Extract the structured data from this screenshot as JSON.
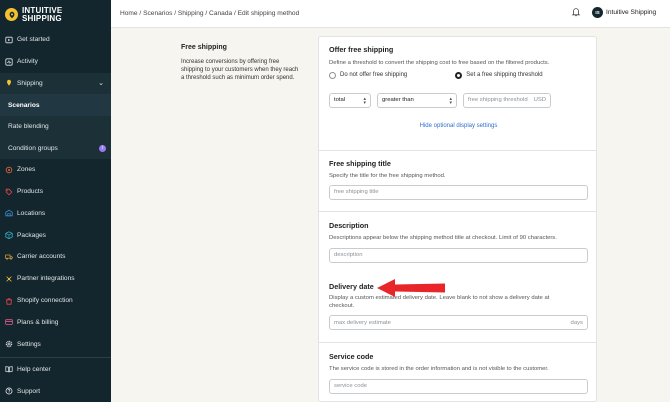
{
  "brand": {
    "line1": "INTUITIVE",
    "line2": "SHIPPING"
  },
  "sidebar": {
    "items": [
      {
        "label": "Get started",
        "icon": "play-icon"
      },
      {
        "label": "Activity",
        "icon": "activity-icon"
      },
      {
        "label": "Shipping",
        "icon": "shipping-icon"
      }
    ],
    "subitems": [
      {
        "label": "Scenarios"
      },
      {
        "label": "Rate blending"
      },
      {
        "label": "Condition groups",
        "badge": "i"
      }
    ],
    "items2": [
      {
        "label": "Zones"
      },
      {
        "label": "Products"
      },
      {
        "label": "Locations"
      },
      {
        "label": "Packages"
      },
      {
        "label": "Carrier accounts"
      },
      {
        "label": "Partner integrations"
      },
      {
        "label": "Shopify connection"
      },
      {
        "label": "Plans & billing"
      },
      {
        "label": "Settings"
      }
    ],
    "bottom": [
      {
        "label": "Help center"
      },
      {
        "label": "Support"
      }
    ]
  },
  "topbar": {
    "breadcrumb": "Home / Scenarios / Shipping / Canada / Edit shipping method",
    "avatar_initials": "IS",
    "user_name": "Intuitive Shipping"
  },
  "left": {
    "title": "Free shipping",
    "description": "Increase conversions by offering free shipping to your customers when they reach a threshold such as minimum order spend."
  },
  "offer": {
    "title": "Offer free shipping",
    "help": "Define a threshold to convert the shipping cost to free based on the filtered products.",
    "option_off": "Do not offer free shipping",
    "option_on": "Set a free shipping threshold",
    "selected": "Set a free shipping threshold",
    "select1": "total",
    "select2": "greater than",
    "threshold_placeholder": "free shipping threshold",
    "threshold_suffix": "USD",
    "link": "Hide optional display settings"
  },
  "title_section": {
    "title": "Free shipping title",
    "help": "Specify the title for the free shipping method.",
    "placeholder": "free shipping title"
  },
  "description_section": {
    "title": "Description",
    "help": "Descriptions appear below the shipping method title at checkout. Limit of 90 characters.",
    "placeholder": "description"
  },
  "delivery": {
    "title": "Delivery date",
    "help": "Display a custom estimated delivery date. Leave blank to not show a delivery date at checkout.",
    "placeholder": "max delivery estimate",
    "suffix": "days"
  },
  "service": {
    "title": "Service code",
    "help": "The service code is stored in the order information and is not visible to the customer.",
    "placeholder": "service code"
  },
  "colors": {
    "sidebar_bg": "#14262d",
    "arrow": "#e8262a",
    "link": "#2c6ecb",
    "brand_yellow": "#f2c230"
  }
}
